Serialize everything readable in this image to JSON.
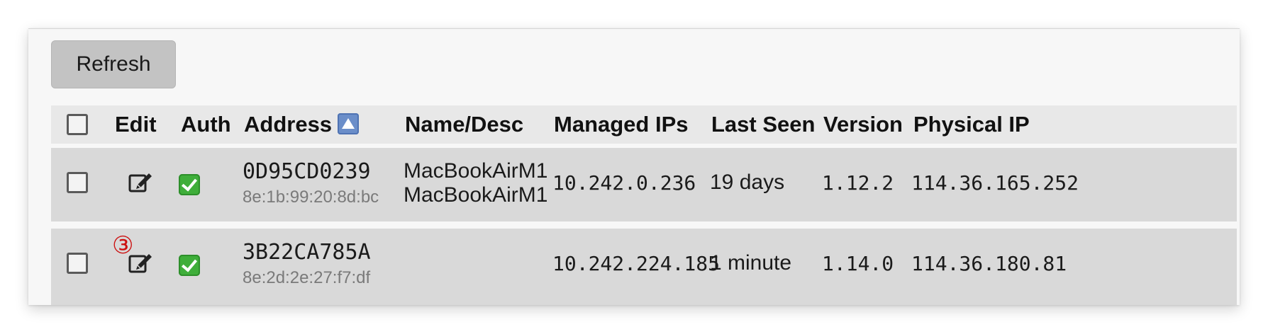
{
  "toolbar": {
    "refresh_label": "Refresh"
  },
  "table": {
    "columns": {
      "edit": "Edit",
      "auth": "Auth",
      "address": "Address",
      "name": "Name/Desc",
      "managed_ips": "Managed IPs",
      "last_seen": "Last Seen",
      "version": "Version",
      "physical_ip": "Physical IP"
    },
    "sort": {
      "column": "address",
      "direction": "ascending",
      "icon": "sort-ascending-icon"
    },
    "rows": [
      {
        "address": "0D95CD0239",
        "mac": "8e:1b:99:20:8d:bc",
        "name": "MacBookAirM1",
        "description": "MacBookAirM1",
        "managed_ip": "10.242.0.236",
        "last_seen": "19 days",
        "version": "1.12.2",
        "physical_ip": "114.36.165.252",
        "authorized": true
      },
      {
        "address": "3B22CA785A",
        "mac": "8e:2d:2e:27:f7:df",
        "name": "",
        "description": "",
        "managed_ip": "10.242.224.185",
        "last_seen": "1 minute",
        "version": "1.14.0",
        "physical_ip": "114.36.180.81",
        "authorized": true
      }
    ]
  },
  "annotation": {
    "marker": "③",
    "color": "#cc1111"
  },
  "colors": {
    "auth_check": "#3fae3a",
    "sort_icon": "#6b8ec9",
    "row_bg": "#d9d9d9",
    "header_bg": "#e8e8e8"
  }
}
